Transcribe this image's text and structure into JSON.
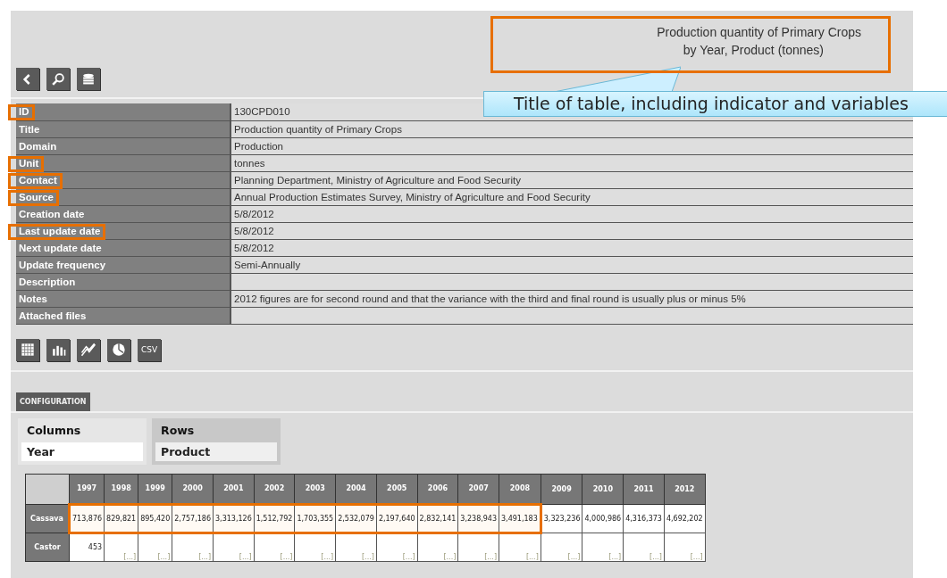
{
  "header": {
    "title_lines": [
      "Production quantity of Primary Crops",
      "by Year, Product (tonnes)"
    ],
    "highlighted": true
  },
  "callout": {
    "text": "Title of table, including indicator and variables"
  },
  "nav_buttons": [
    {
      "kind": "back"
    },
    {
      "kind": "search"
    },
    {
      "kind": "database"
    }
  ],
  "metadata": [
    {
      "label": "ID",
      "value": "130CPD010",
      "highlighted": true
    },
    {
      "label": "Title",
      "value": "Production quantity of Primary Crops",
      "highlighted": false
    },
    {
      "label": "Domain",
      "value": "Production",
      "highlighted": false
    },
    {
      "label": "Unit",
      "value": "tonnes",
      "highlighted": true
    },
    {
      "label": "Contact",
      "value": "Planning Department, Ministry of Agriculture and Food Security",
      "highlighted": true
    },
    {
      "label": "Source",
      "value": "Annual Production Estimates Survey, Ministry of Agriculture and Food Security",
      "highlighted": true
    },
    {
      "label": "Creation date",
      "value": "5/8/2012",
      "highlighted": false
    },
    {
      "label": "Last update date",
      "value": "5/8/2012",
      "highlighted": true
    },
    {
      "label": "Next update date",
      "value": "5/8/2012",
      "highlighted": false
    },
    {
      "label": "Update frequency",
      "value": "Semi-Annually",
      "highlighted": false
    },
    {
      "label": "Description",
      "highlighted": false
    },
    {
      "label": "Notes",
      "value": "2012 figures are for second round and that the variance with the third and final round is usually plus or minus 5%",
      "highlighted": false
    },
    {
      "label": "Attached files",
      "highlighted": false
    }
  ],
  "view_buttons": [
    {
      "kind": "table"
    },
    {
      "kind": "bar"
    },
    {
      "kind": "line"
    },
    {
      "kind": "pie"
    },
    {
      "kind": "csv",
      "label": "CSV"
    }
  ],
  "configuration_button": "CONFIGURATION",
  "layout_zones": [
    {
      "heading": "Columns",
      "value": "Year",
      "selected": true
    },
    {
      "heading": "Rows",
      "value": "Product",
      "selected": false
    }
  ],
  "table": {
    "columns": [
      "1997",
      "1998",
      "1999",
      "2000",
      "2001",
      "2002",
      "2003",
      "2004",
      "2005",
      "2006",
      "2007",
      "2008",
      "2009",
      "2010",
      "2011",
      "2012"
    ],
    "rows": [
      {
        "label": "Cassava",
        "cells": [
          {
            "value": "713,876",
            "highlighted": true
          },
          {
            "value": "829,821",
            "highlighted": true
          },
          {
            "value": "895,420",
            "highlighted": true
          },
          {
            "value": "2,757,186",
            "highlighted": true
          },
          {
            "value": "3,313,126",
            "highlighted": true
          },
          {
            "value": "1,512,792",
            "highlighted": true
          },
          {
            "value": "1,703,355",
            "highlighted": true
          },
          {
            "value": "2,532,079",
            "highlighted": true
          },
          {
            "value": "2,197,640",
            "highlighted": true
          },
          {
            "value": "2,832,141",
            "highlighted": true
          },
          {
            "value": "3,238,943",
            "highlighted": true
          },
          {
            "value": "3,491,183",
            "highlighted": true
          },
          {
            "value": "3,323,236",
            "highlighted": false
          },
          {
            "value": "4,000,986",
            "highlighted": false
          },
          {
            "value": "4,316,373",
            "highlighted": false
          },
          {
            "value": "4,692,202",
            "highlighted": false
          }
        ]
      },
      {
        "label": "Castor",
        "cells": [
          {
            "value": "453",
            "highlighted": false
          },
          {
            "value": "[...]",
            "highlighted": false
          },
          {
            "value": "[...]",
            "highlighted": false
          },
          {
            "value": "[...]",
            "highlighted": false
          },
          {
            "value": "[...]",
            "highlighted": false
          },
          {
            "value": "[...]",
            "highlighted": false
          },
          {
            "value": "[...]",
            "highlighted": false
          },
          {
            "value": "[...]",
            "highlighted": false
          },
          {
            "value": "[...]",
            "highlighted": false
          },
          {
            "value": "[...]",
            "highlighted": false
          },
          {
            "value": "[...]",
            "highlighted": false
          },
          {
            "value": "[...]",
            "highlighted": false
          },
          {
            "value": "[...]",
            "highlighted": false
          },
          {
            "value": "[...]",
            "highlighted": false
          },
          {
            "value": "[...]",
            "highlighted": false
          },
          {
            "value": "[...]",
            "highlighted": false
          }
        ]
      }
    ]
  }
}
